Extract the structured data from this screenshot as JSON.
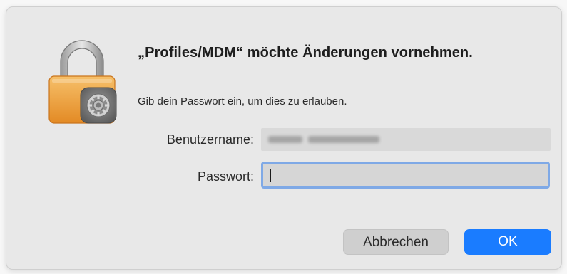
{
  "dialog": {
    "title": "„Profiles/MDM“ möchte Änderungen vornehmen.",
    "subtitle": "Gib dein Passwort ein, um dies zu erlauben.",
    "username_label": "Benutzername:",
    "username_value_visibility": "blurred",
    "password_label": "Passwort:",
    "password_value": "",
    "cancel_label": "Abbrechen",
    "ok_label": "OK",
    "icon": "padlock-gear-icon"
  },
  "colors": {
    "dialog_bg": "#e8e8e8",
    "ok_button": "#1a7cff",
    "focus_ring": "#7fa9e6",
    "lock_gold": "#f0a53c"
  }
}
